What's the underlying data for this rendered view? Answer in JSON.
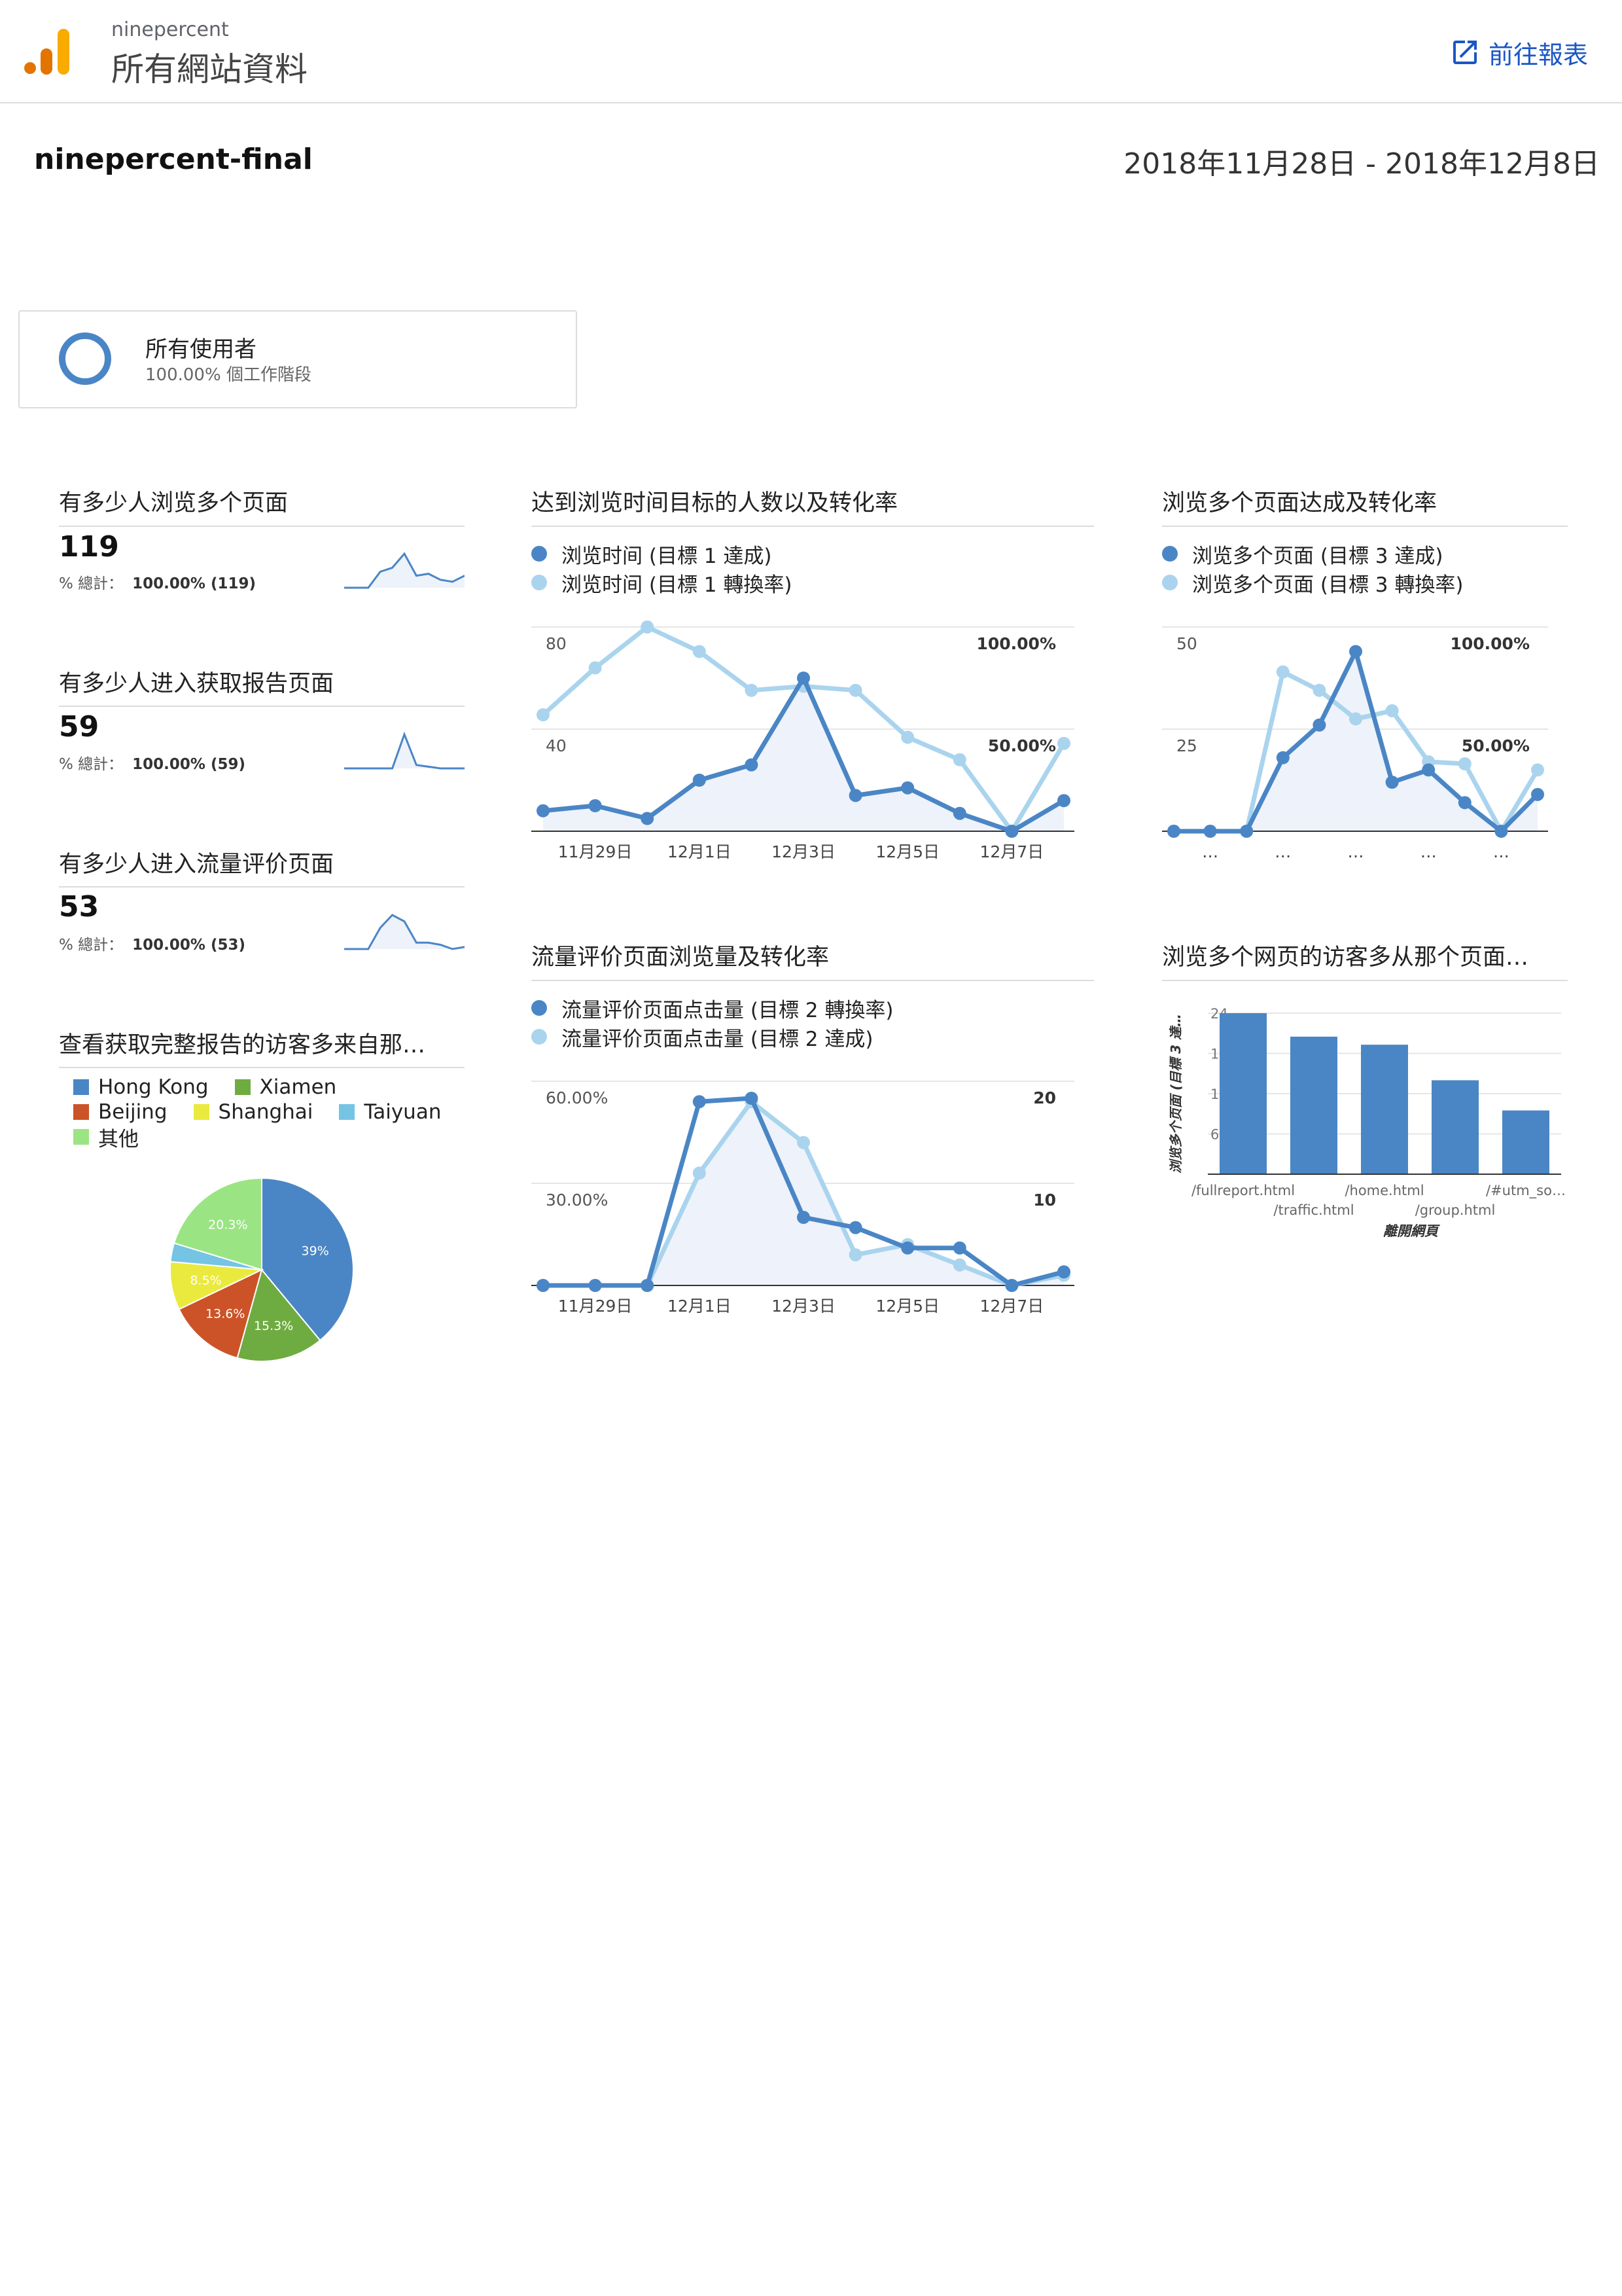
{
  "header": {
    "account": "ninepercent",
    "property": "所有網站資料",
    "goto_report": "前往報表"
  },
  "report": {
    "name": "ninepercent-final",
    "date_range": "2018年11月28日 - 2018年12月8日"
  },
  "segment": {
    "name": "所有使用者",
    "sessions": "100.00% 個工作階段"
  },
  "metrics": [
    {
      "title": "有多少人浏览多个页面",
      "value": "119",
      "total_label": "% 總計：",
      "total_value": "100.00% (119)",
      "spark": [
        0,
        0,
        0,
        8,
        10,
        17,
        6,
        7,
        4,
        3,
        6
      ]
    },
    {
      "title": "有多少人进入获取报告页面",
      "value": "59",
      "total_label": "% 總計：",
      "total_value": "100.00% (59)",
      "spark": [
        0,
        0,
        0,
        0,
        0,
        20,
        2,
        1,
        0,
        0,
        0
      ]
    },
    {
      "title": "有多少人进入流量评价页面",
      "value": "53",
      "total_label": "% 總計：",
      "total_value": "100.00% (53)",
      "spark": [
        0,
        0,
        0,
        10,
        16,
        13,
        3,
        3,
        2,
        0,
        1
      ]
    }
  ],
  "charts": {
    "time_goal": {
      "title": "达到浏览时间目标的人数以及转化率",
      "legend": [
        "浏览时间 (目標 1 達成)",
        "浏览时间 (目標 1 轉換率)"
      ],
      "left_ticks": [
        "80",
        "40"
      ],
      "right_ticks": [
        "100.00%",
        "50.00%"
      ],
      "x_labels": [
        "11月29日",
        "12月1日",
        "12月3日",
        "12月5日",
        "12月7日"
      ]
    },
    "pages_goal": {
      "title": "浏览多个页面达成及转化率",
      "legend": [
        "浏览多个页面 (目標 3 達成)",
        "浏览多个页面 (目標 3 轉換率)"
      ],
      "left_ticks": [
        "50",
        "25"
      ],
      "right_ticks": [
        "100.00%",
        "50.00%"
      ],
      "x_labels": [
        "…",
        "…",
        "…",
        "…",
        "…"
      ]
    },
    "traffic_goal": {
      "title": "流量评价页面浏览量及转化率",
      "legend": [
        "流量评价页面点击量 (目標 2 轉換率)",
        "流量评价页面点击量 (目標 2 達成)"
      ],
      "left_ticks": [
        "60.00%",
        "30.00%"
      ],
      "right_ticks": [
        "20",
        "10"
      ],
      "x_labels": [
        "11月29日",
        "12月1日",
        "12月3日",
        "12月5日",
        "12月7日"
      ]
    },
    "exit_pages": {
      "title": "浏览多个网页的访客多从那个页面…",
      "y_title": "浏览多个页面 (目標 3 達…",
      "y_ticks": [
        "24",
        "18",
        "12",
        "6"
      ],
      "x_title": "離開網頁"
    },
    "cities": {
      "title": "查看获取完整报告的访客多来自那…"
    }
  },
  "chart_data": [
    {
      "type": "line",
      "title": "达到浏览时间目标的人数以及转化率",
      "x": [
        "11月28日",
        "11月29日",
        "11月30日",
        "12月1日",
        "12月2日",
        "12月3日",
        "12月4日",
        "12月5日",
        "12月6日",
        "12月7日",
        "12月8日"
      ],
      "series": [
        {
          "name": "浏览时间 (目標 1 達成)",
          "axis": "left",
          "values": [
            8,
            10,
            5,
            20,
            26,
            60,
            14,
            17,
            7,
            0,
            12
          ]
        },
        {
          "name": "浏览时间 (目標 1 轉換率)",
          "axis": "right",
          "values": [
            57,
            80,
            100,
            88,
            69,
            71,
            69,
            46,
            35,
            0,
            43
          ]
        }
      ],
      "left_ylim": [
        0,
        80
      ],
      "right_ylim": [
        0,
        100
      ],
      "colors": [
        "#4a86c5",
        "#aad4ee"
      ]
    },
    {
      "type": "line",
      "title": "浏览多个页面达成及转化率",
      "x": [
        "11月28日",
        "11月29日",
        "11月30日",
        "12月1日",
        "12月2日",
        "12月3日",
        "12月4日",
        "12月5日",
        "12月6日",
        "12月7日",
        "12月8日"
      ],
      "series": [
        {
          "name": "浏览多个页面 (目標 3 達成)",
          "axis": "left",
          "values": [
            0,
            0,
            0,
            18,
            26,
            44,
            12,
            15,
            7,
            0,
            9
          ]
        },
        {
          "name": "浏览多个页面 (目標 3 轉換率)",
          "axis": "right",
          "values": [
            0,
            0,
            0,
            78,
            69,
            55,
            59,
            34,
            33,
            0,
            30
          ]
        }
      ],
      "left_ylim": [
        0,
        50
      ],
      "right_ylim": [
        0,
        100
      ],
      "colors": [
        "#4a86c5",
        "#aad4ee"
      ]
    },
    {
      "type": "line",
      "title": "流量评价页面浏览量及转化率",
      "x": [
        "11月28日",
        "11月29日",
        "11月30日",
        "12月1日",
        "12月2日",
        "12月3日",
        "12月4日",
        "12月5日",
        "12月6日",
        "12月7日",
        "12月8日"
      ],
      "series": [
        {
          "name": "流量评价页面点击量 (目標 2 轉換率)",
          "axis": "left",
          "values": [
            0,
            0,
            0,
            54,
            55,
            20,
            17,
            11,
            11,
            0,
            4
          ]
        },
        {
          "name": "流量评价页面点击量 (目標 2 達成)",
          "axis": "right",
          "values": [
            0,
            0,
            0,
            11,
            18,
            14,
            3,
            4,
            2,
            0,
            1
          ]
        }
      ],
      "left_ylim": [
        0,
        60
      ],
      "right_ylim": [
        0,
        20
      ],
      "colors": [
        "#4a86c5",
        "#aad4ee"
      ]
    },
    {
      "type": "bar",
      "title": "浏览多个网页的访客多从那个页面…",
      "categories": [
        "/fullreport.html",
        "/traffic.html",
        "/home.html",
        "/group.html",
        "/#utm_so…"
      ],
      "values": [
        24,
        20.5,
        19.3,
        14,
        9.5
      ],
      "xlabel": "離開網頁",
      "ylabel": "浏览多个页面 (目標 3 達…",
      "ylim": [
        0,
        24
      ],
      "color": "#4a86c5"
    },
    {
      "type": "pie",
      "title": "查看获取完整报告的访客多来自那…",
      "labels": [
        "Hong Kong",
        "Xiamen",
        "Beijing",
        "Shanghai",
        "Taiyuan",
        "其他"
      ],
      "values": [
        39,
        15.3,
        13.6,
        8.5,
        3.3,
        20.3
      ],
      "value_labels": [
        "39%",
        "15.3%",
        "13.6%",
        "8.5%",
        "",
        "20.3%"
      ],
      "colors": [
        "#4a86c5",
        "#6eac41",
        "#cc5327",
        "#eaea3e",
        "#75c4e4",
        "#9be484"
      ]
    }
  ]
}
